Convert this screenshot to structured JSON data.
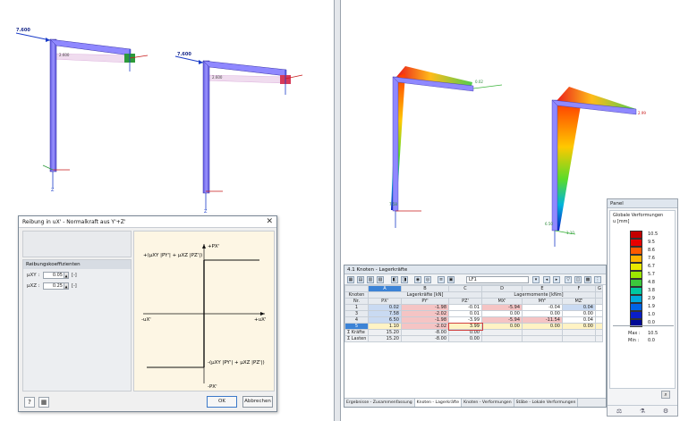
{
  "left_view": {
    "load_left": "7.600",
    "load_right": "7.600",
    "dim_left": "2.600",
    "dim_right": "2.600"
  },
  "right_view": {
    "label_a": "0.02",
    "label_b": "7.58",
    "label_c": "2.99",
    "label_d": "6.50",
    "label_e": "1.10"
  },
  "dialog": {
    "title": "Reibung in uX' - Normalkraft aus Y'+Z'",
    "close": "✕",
    "group_title": "Reibungskoeffizienten",
    "coefficients": [
      {
        "label": "μXY :",
        "value": "0.05",
        "unit": "[-]"
      },
      {
        "label": "μXZ :",
        "value": "0.25",
        "unit": "[-]"
      }
    ],
    "diagram": {
      "axis_top": "+PX'",
      "axis_bottom": "-PX'",
      "axis_left": "-uX'",
      "axis_right": "+uX'",
      "formula_top": "+(μXY |PY'| + μXZ |PZ'|)",
      "formula_bottom": "-(μXY |PY'| + μXZ |PZ'|)"
    },
    "ok_label": "OK",
    "cancel_label": "Abbrechen"
  },
  "results": {
    "title": "4.1 Knoten - Lagerkräfte",
    "lf": "LF1",
    "col_letters": [
      "A",
      "B",
      "C",
      "D",
      "E",
      "F",
      "G"
    ],
    "group_forces": "Lagerkräfte [kN]",
    "group_moments": "Lagermomente [kNm]",
    "knoten_label": "Knoten",
    "nr_label": "Nr.",
    "subheads": [
      "PX'",
      "PY'",
      "PZ'",
      "MX'",
      "MY'",
      "MZ'"
    ],
    "rows": [
      {
        "nr": "1",
        "vals": [
          "0.02",
          "-1.98",
          "-0.01",
          "-5.94",
          "-0.04",
          "0.04"
        ]
      },
      {
        "nr": "3",
        "vals": [
          "7.58",
          "-2.02",
          "0.01",
          "0.00",
          "0.00",
          "0.00"
        ]
      },
      {
        "nr": "4",
        "vals": [
          "6.50",
          "-1.98",
          "-3.99",
          "-5.94",
          "-11.54",
          "0.04"
        ]
      },
      {
        "nr": "5",
        "vals": [
          "1.10",
          "-2.02",
          "3.99",
          "0.00",
          "0.00",
          "0.00"
        ]
      }
    ],
    "sum_rows": [
      {
        "label": "Σ Kräfte",
        "vals": [
          "15.20",
          "-8.00",
          "0.00"
        ]
      },
      {
        "label": "Σ Lasten",
        "vals": [
          "15.20",
          "-8.00",
          "0.00"
        ]
      }
    ],
    "tabs": [
      "Ergebnisse - Zusammenfassung",
      "Knoten - Lagerkräfte",
      "Knoten - Verformungen",
      "Stäbe - Lokale Verformungen"
    ]
  },
  "legend": {
    "title": "Panel",
    "heading": "Globale Verformungen",
    "unit": "u [mm]",
    "scale": [
      {
        "value": "10.5",
        "color": "#c40000"
      },
      {
        "value": "9.5",
        "color": "#e80000"
      },
      {
        "value": "8.6",
        "color": "#ff5a00"
      },
      {
        "value": "7.6",
        "color": "#ffb400"
      },
      {
        "value": "6.7",
        "color": "#e8e800"
      },
      {
        "value": "5.7",
        "color": "#9ce600"
      },
      {
        "value": "4.8",
        "color": "#3cc83c"
      },
      {
        "value": "3.8",
        "color": "#00c8a0"
      },
      {
        "value": "2.9",
        "color": "#00aadc"
      },
      {
        "value": "1.9",
        "color": "#0064e6"
      },
      {
        "value": "1.0",
        "color": "#0a1ec8"
      },
      {
        "value": "0.0",
        "color": "#000a96"
      }
    ],
    "max_label": "Max :",
    "max_value": "10.5",
    "min_label": "Min :",
    "min_value": "0.0"
  }
}
